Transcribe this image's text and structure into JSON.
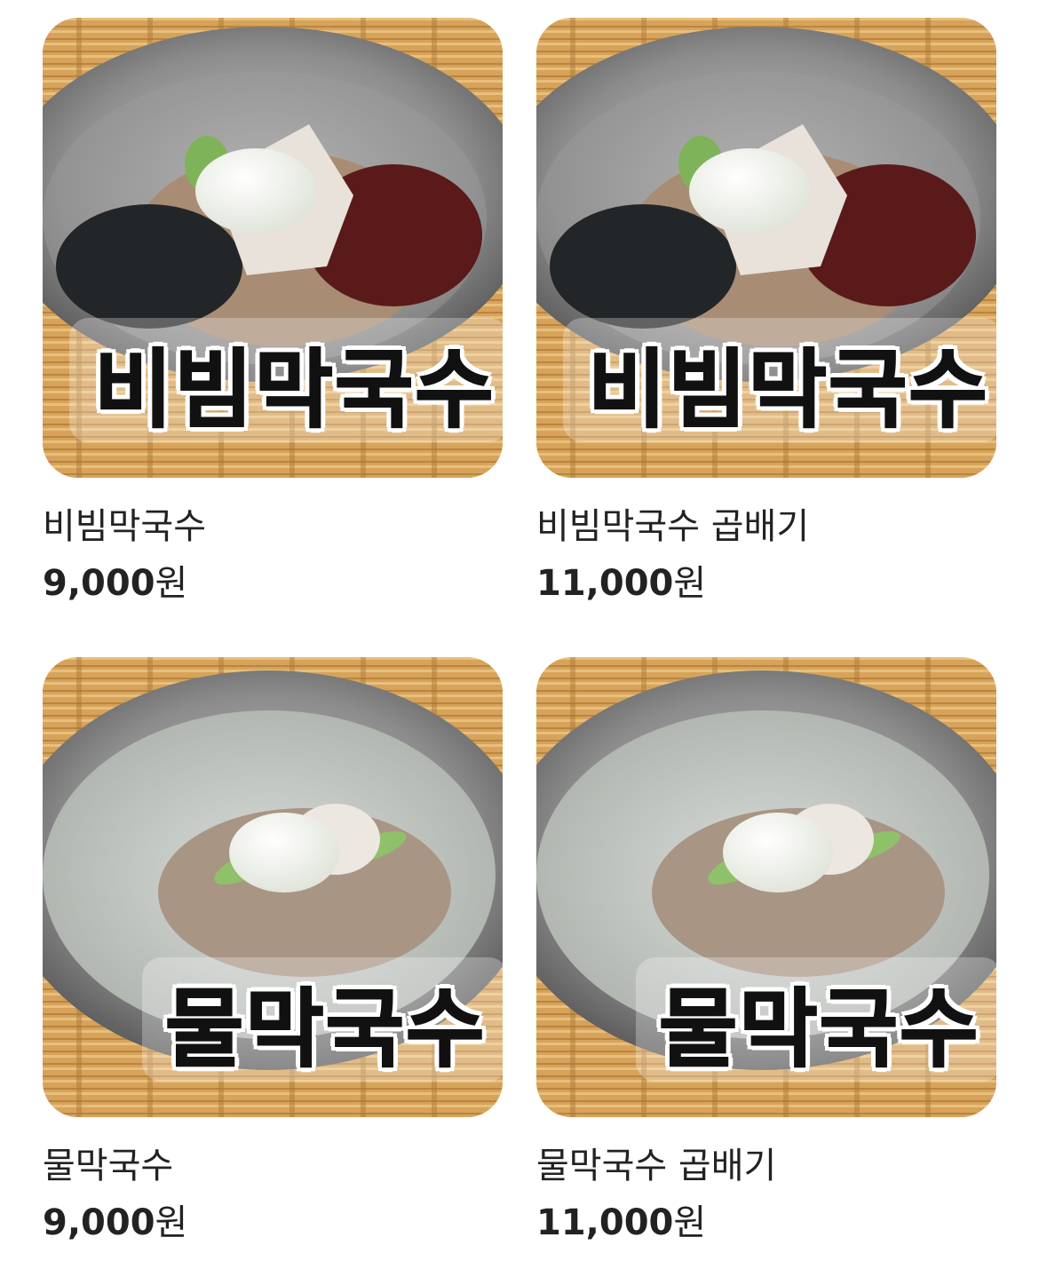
{
  "menu_items": [
    {
      "name": "비빔막국수",
      "price_amount": "9,000",
      "price_unit": "원",
      "image_label": "비빔막국수"
    },
    {
      "name": "비빔막국수 곱배기",
      "price_amount": "11,000",
      "price_unit": "원",
      "image_label": "비빔막국수"
    },
    {
      "name": "물막국수",
      "price_amount": "9,000",
      "price_unit": "원",
      "image_label": "물막국수"
    },
    {
      "name": "물막국수 곱배기",
      "price_amount": "11,000",
      "price_unit": "원",
      "image_label": "물막국수"
    }
  ],
  "colors": {
    "text": "#222222",
    "background": "#ffffff",
    "mat": "#d9a860"
  }
}
